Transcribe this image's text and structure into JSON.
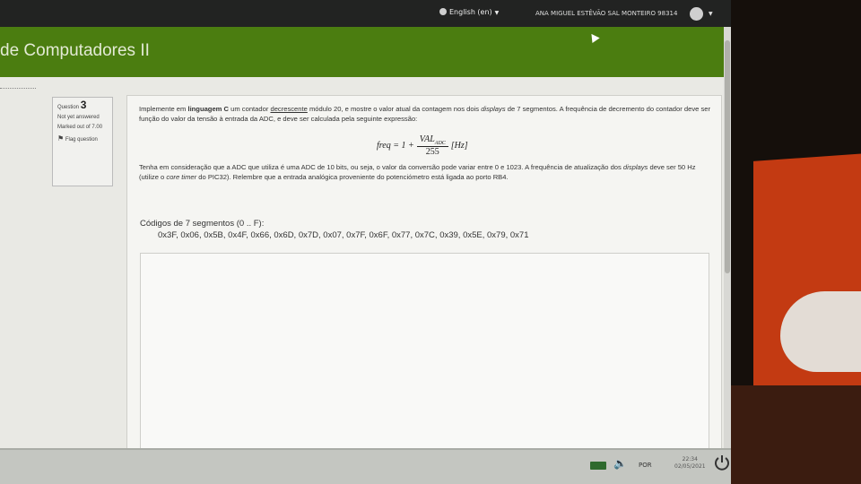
{
  "topbar": {
    "language": "English (en)",
    "user": "ANA MIGUEL ESTÊVÃO SAL MONTEIRO 98314"
  },
  "banner": {
    "course_title": "de Computadores II"
  },
  "question_info": {
    "question_label": "Question",
    "question_number": "3",
    "status": "Not yet answered",
    "marked_out_of": "Marked out of 7.00",
    "flag": "Flag question"
  },
  "question": {
    "p1_a": "Implemente em ",
    "p1_b": "linguagem C",
    "p1_c": " um contador ",
    "p1_d": "decrescente",
    "p1_e": " módulo 20, e mostre o valor atual da contagem nos dois ",
    "p1_f": "displays",
    "p1_g": " de 7 segmentos. A frequência de decremento do contador deve ser função do valor da tensão à entrada da ADC, e deve ser calculada pela seguinte expressão:",
    "formula_lhs": "freq = 1 +",
    "formula_num": "VAL",
    "formula_sub": "ADC",
    "formula_den": "255",
    "formula_unit": "[Hz]",
    "p2_a": "Tenha em consideração que a ADC que utiliza é uma ADC de 10 bits, ou seja, o valor da conversão pode variar entre 0 e 1023. A frequência de atualização dos ",
    "p2_b": "displays",
    "p2_c": " deve ser 50 Hz (utilize o ",
    "p2_d": "core timer",
    "p2_e": " do PIC32). Relembre que a entrada analógica proveniente do potenciómetro está ligada ao porto RB4.",
    "codes_label": "Códigos de 7 segmentos (0 .. F):",
    "codes": "0x3F, 0x06, 0x5B, 0x4F, 0x66, 0x6D, 0x7D, 0x07, 0x7F, 0x6F, 0x77, 0x7C, 0x39, 0x5E, 0x79, 0x71"
  },
  "taskbar": {
    "keyboard": "POR",
    "time": "22:34",
    "date": "02/05/2021"
  },
  "icons": {
    "globe": "globe-icon",
    "avatar": "user-avatar-icon",
    "flag": "flag-icon",
    "battery": "battery-icon",
    "speaker": "speaker-icon",
    "power": "power-icon"
  }
}
